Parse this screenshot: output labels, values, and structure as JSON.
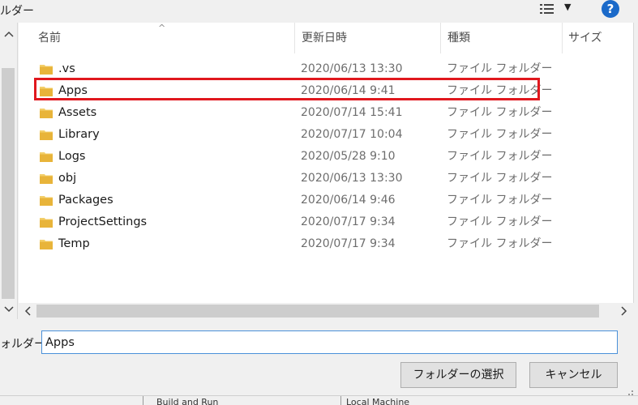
{
  "window": {
    "title_fragment": "ルダー"
  },
  "toolbar": {
    "view_icon": "view-options-icon",
    "caret": "▼",
    "help_label": "?"
  },
  "columns": {
    "name": "名前",
    "modified": "更新日時",
    "type": "種類",
    "size": "サイズ",
    "sort_caret": "^"
  },
  "files": [
    {
      "name": ".vs",
      "modified": "2020/06/13 13:30",
      "type": "ファイル フォルダー"
    },
    {
      "name": "Apps",
      "modified": "2020/06/14 9:41",
      "type": "ファイル フォルダー"
    },
    {
      "name": "Assets",
      "modified": "2020/07/14 15:41",
      "type": "ファイル フォルダー"
    },
    {
      "name": "Library",
      "modified": "2020/07/17 10:04",
      "type": "ファイル フォルダー"
    },
    {
      "name": "Logs",
      "modified": "2020/05/28 9:10",
      "type": "ファイル フォルダー"
    },
    {
      "name": "obj",
      "modified": "2020/06/13 13:30",
      "type": "ファイル フォルダー"
    },
    {
      "name": "Packages",
      "modified": "2020/06/14 9:46",
      "type": "ファイル フォルダー"
    },
    {
      "name": "ProjectSettings",
      "modified": "2020/07/17 9:34",
      "type": "ファイル フォルダー"
    },
    {
      "name": "Temp",
      "modified": "2020/07/17 9:34",
      "type": "ファイル フォルダー"
    }
  ],
  "folder_field": {
    "label": "ォルダー:",
    "value": "Apps"
  },
  "buttons": {
    "select": "フォルダーの選択",
    "cancel": "キャンセル"
  },
  "background_window": {
    "frag1": "Build and Run",
    "frag2": "Local Machine"
  },
  "colors": {
    "highlight": "#e0181e",
    "help": "#1b6ac9",
    "folder": "#e8b43a"
  }
}
